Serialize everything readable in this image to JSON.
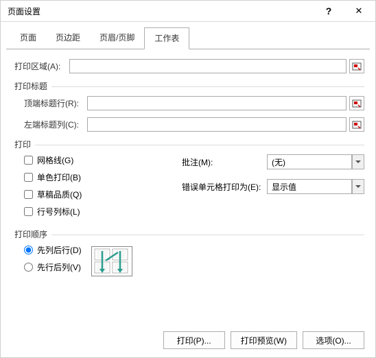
{
  "title": "页面设置",
  "tabs": {
    "page": "页面",
    "margins": "页边距",
    "headerfooter": "页眉/页脚",
    "sheet": "工作表"
  },
  "printArea": {
    "label": "打印区域(A):",
    "value": ""
  },
  "printTitles": {
    "section": "打印标题",
    "topRow": {
      "label": "顶端标题行(R):",
      "value": ""
    },
    "leftCol": {
      "label": "左端标题列(C):",
      "value": ""
    }
  },
  "printOptions": {
    "section": "打印",
    "gridlines": "网格线(G)",
    "blackwhite": "单色打印(B)",
    "draft": "草稿品质(Q)",
    "rowcol": "行号列标(L)",
    "comments": {
      "label": "批注(M):",
      "value": "(无)"
    },
    "errors": {
      "label": "错误单元格打印为(E):",
      "value": "显示值"
    }
  },
  "pageOrder": {
    "section": "打印顺序",
    "downOver": "先列后行(D)",
    "overDown": "先行后列(V)"
  },
  "buttons": {
    "print": "打印(P)...",
    "preview": "打印预览(W)",
    "options": "选项(O)..."
  }
}
